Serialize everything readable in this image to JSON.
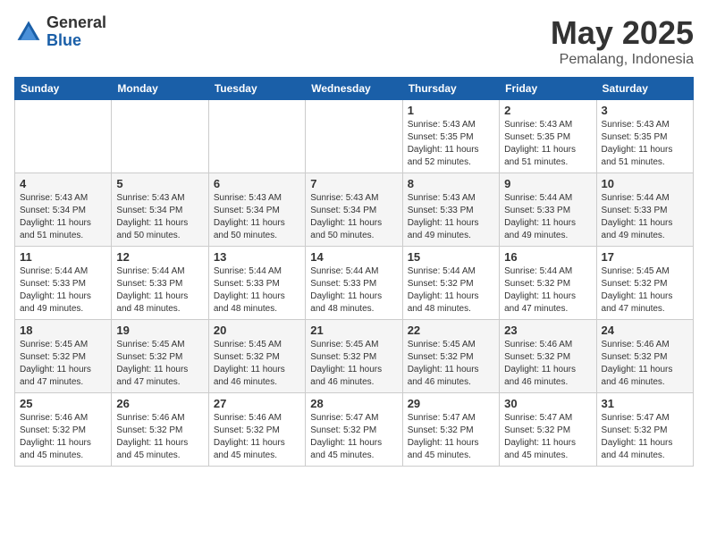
{
  "logo": {
    "general": "General",
    "blue": "Blue"
  },
  "header": {
    "month": "May 2025",
    "location": "Pemalang, Indonesia"
  },
  "weekdays": [
    "Sunday",
    "Monday",
    "Tuesday",
    "Wednesday",
    "Thursday",
    "Friday",
    "Saturday"
  ],
  "weeks": [
    [
      {
        "day": "",
        "info": ""
      },
      {
        "day": "",
        "info": ""
      },
      {
        "day": "",
        "info": ""
      },
      {
        "day": "",
        "info": ""
      },
      {
        "day": "1",
        "info": "Sunrise: 5:43 AM\nSunset: 5:35 PM\nDaylight: 11 hours\nand 52 minutes."
      },
      {
        "day": "2",
        "info": "Sunrise: 5:43 AM\nSunset: 5:35 PM\nDaylight: 11 hours\nand 51 minutes."
      },
      {
        "day": "3",
        "info": "Sunrise: 5:43 AM\nSunset: 5:35 PM\nDaylight: 11 hours\nand 51 minutes."
      }
    ],
    [
      {
        "day": "4",
        "info": "Sunrise: 5:43 AM\nSunset: 5:34 PM\nDaylight: 11 hours\nand 51 minutes."
      },
      {
        "day": "5",
        "info": "Sunrise: 5:43 AM\nSunset: 5:34 PM\nDaylight: 11 hours\nand 50 minutes."
      },
      {
        "day": "6",
        "info": "Sunrise: 5:43 AM\nSunset: 5:34 PM\nDaylight: 11 hours\nand 50 minutes."
      },
      {
        "day": "7",
        "info": "Sunrise: 5:43 AM\nSunset: 5:34 PM\nDaylight: 11 hours\nand 50 minutes."
      },
      {
        "day": "8",
        "info": "Sunrise: 5:43 AM\nSunset: 5:33 PM\nDaylight: 11 hours\nand 49 minutes."
      },
      {
        "day": "9",
        "info": "Sunrise: 5:44 AM\nSunset: 5:33 PM\nDaylight: 11 hours\nand 49 minutes."
      },
      {
        "day": "10",
        "info": "Sunrise: 5:44 AM\nSunset: 5:33 PM\nDaylight: 11 hours\nand 49 minutes."
      }
    ],
    [
      {
        "day": "11",
        "info": "Sunrise: 5:44 AM\nSunset: 5:33 PM\nDaylight: 11 hours\nand 49 minutes."
      },
      {
        "day": "12",
        "info": "Sunrise: 5:44 AM\nSunset: 5:33 PM\nDaylight: 11 hours\nand 48 minutes."
      },
      {
        "day": "13",
        "info": "Sunrise: 5:44 AM\nSunset: 5:33 PM\nDaylight: 11 hours\nand 48 minutes."
      },
      {
        "day": "14",
        "info": "Sunrise: 5:44 AM\nSunset: 5:33 PM\nDaylight: 11 hours\nand 48 minutes."
      },
      {
        "day": "15",
        "info": "Sunrise: 5:44 AM\nSunset: 5:32 PM\nDaylight: 11 hours\nand 48 minutes."
      },
      {
        "day": "16",
        "info": "Sunrise: 5:44 AM\nSunset: 5:32 PM\nDaylight: 11 hours\nand 47 minutes."
      },
      {
        "day": "17",
        "info": "Sunrise: 5:45 AM\nSunset: 5:32 PM\nDaylight: 11 hours\nand 47 minutes."
      }
    ],
    [
      {
        "day": "18",
        "info": "Sunrise: 5:45 AM\nSunset: 5:32 PM\nDaylight: 11 hours\nand 47 minutes."
      },
      {
        "day": "19",
        "info": "Sunrise: 5:45 AM\nSunset: 5:32 PM\nDaylight: 11 hours\nand 47 minutes."
      },
      {
        "day": "20",
        "info": "Sunrise: 5:45 AM\nSunset: 5:32 PM\nDaylight: 11 hours\nand 46 minutes."
      },
      {
        "day": "21",
        "info": "Sunrise: 5:45 AM\nSunset: 5:32 PM\nDaylight: 11 hours\nand 46 minutes."
      },
      {
        "day": "22",
        "info": "Sunrise: 5:45 AM\nSunset: 5:32 PM\nDaylight: 11 hours\nand 46 minutes."
      },
      {
        "day": "23",
        "info": "Sunrise: 5:46 AM\nSunset: 5:32 PM\nDaylight: 11 hours\nand 46 minutes."
      },
      {
        "day": "24",
        "info": "Sunrise: 5:46 AM\nSunset: 5:32 PM\nDaylight: 11 hours\nand 46 minutes."
      }
    ],
    [
      {
        "day": "25",
        "info": "Sunrise: 5:46 AM\nSunset: 5:32 PM\nDaylight: 11 hours\nand 45 minutes."
      },
      {
        "day": "26",
        "info": "Sunrise: 5:46 AM\nSunset: 5:32 PM\nDaylight: 11 hours\nand 45 minutes."
      },
      {
        "day": "27",
        "info": "Sunrise: 5:46 AM\nSunset: 5:32 PM\nDaylight: 11 hours\nand 45 minutes."
      },
      {
        "day": "28",
        "info": "Sunrise: 5:47 AM\nSunset: 5:32 PM\nDaylight: 11 hours\nand 45 minutes."
      },
      {
        "day": "29",
        "info": "Sunrise: 5:47 AM\nSunset: 5:32 PM\nDaylight: 11 hours\nand 45 minutes."
      },
      {
        "day": "30",
        "info": "Sunrise: 5:47 AM\nSunset: 5:32 PM\nDaylight: 11 hours\nand 45 minutes."
      },
      {
        "day": "31",
        "info": "Sunrise: 5:47 AM\nSunset: 5:32 PM\nDaylight: 11 hours\nand 44 minutes."
      }
    ]
  ]
}
